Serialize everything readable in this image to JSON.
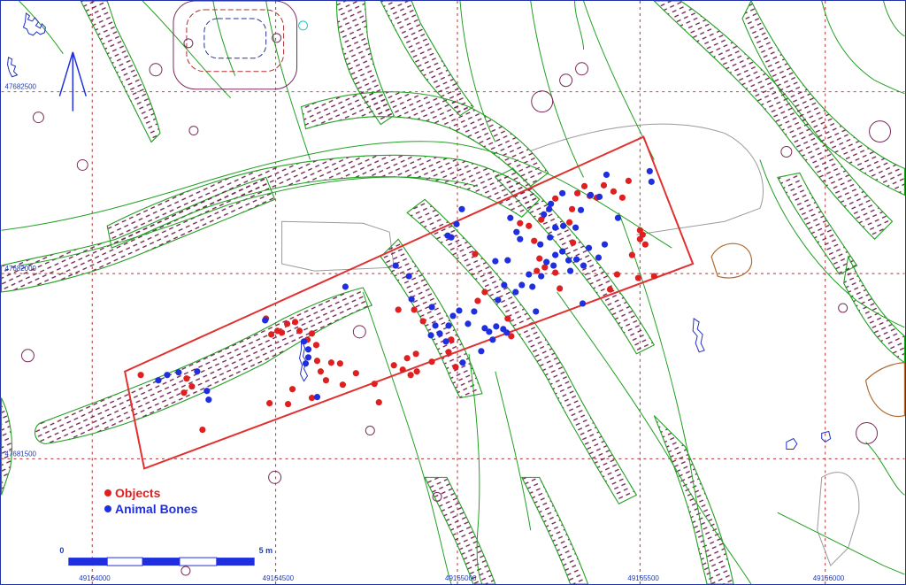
{
  "legend": {
    "objects": {
      "label": "Objects",
      "color": "#e02020"
    },
    "bones": {
      "label": "Animal Bones",
      "color": "#1f2fe0"
    }
  },
  "scale": {
    "start": "0",
    "end": "5 m"
  },
  "grid": {
    "x_labels": [
      "49164000",
      "49164500",
      "49165000",
      "49165500",
      "49166000"
    ],
    "y_labels": [
      "47682500",
      "47682000",
      "47681500"
    ]
  },
  "north_arrow": {
    "icon": "north-arrow-icon"
  },
  "colors": {
    "grid": "#b03030",
    "contours": "#22a022",
    "hatch": "#6a1a4a",
    "trench_box": "#e03030",
    "gray_outline": "#9a9a9a",
    "brown_outline": "#b06a30"
  },
  "finds": {
    "objects": [
      [
        158,
        424
      ],
      [
        210,
        428
      ],
      [
        216,
        437
      ],
      [
        207,
        444
      ],
      [
        228,
        486
      ],
      [
        300,
        360
      ],
      [
        313,
        374
      ],
      [
        306,
        378
      ],
      [
        318,
        376
      ],
      [
        324,
        366
      ],
      [
        333,
        364
      ],
      [
        338,
        374
      ],
      [
        347,
        384
      ],
      [
        352,
        377
      ],
      [
        357,
        390
      ],
      [
        358,
        408
      ],
      [
        362,
        420
      ],
      [
        368,
        430
      ],
      [
        374,
        410
      ],
      [
        384,
        411
      ],
      [
        387,
        435
      ],
      [
        330,
        440
      ],
      [
        352,
        450
      ],
      [
        325,
        457
      ],
      [
        304,
        456
      ],
      [
        402,
        422
      ],
      [
        428,
        455
      ],
      [
        423,
        434
      ],
      [
        445,
        413
      ],
      [
        455,
        418
      ],
      [
        460,
        405
      ],
      [
        470,
        400
      ],
      [
        464,
        424
      ],
      [
        471,
        420
      ],
      [
        450,
        350
      ],
      [
        468,
        350
      ],
      [
        478,
        363
      ],
      [
        510,
        384
      ],
      [
        488,
        409
      ],
      [
        507,
        398
      ],
      [
        515,
        415
      ],
      [
        540,
        340
      ],
      [
        548,
        330
      ],
      [
        574,
        360
      ],
      [
        578,
        380
      ],
      [
        537,
        287
      ],
      [
        598,
        255
      ],
      [
        604,
        272
      ],
      [
        610,
        292
      ],
      [
        607,
        306
      ],
      [
        616,
        302
      ],
      [
        628,
        308
      ],
      [
        633,
        326
      ],
      [
        653,
        218
      ],
      [
        661,
        210
      ],
      [
        667,
        221
      ],
      [
        675,
        223
      ],
      [
        683,
        209
      ],
      [
        694,
        216
      ],
      [
        704,
        223
      ],
      [
        711,
        204
      ],
      [
        644,
        251
      ],
      [
        648,
        274
      ],
      [
        628,
        224
      ],
      [
        647,
        236
      ],
      [
        588,
        252
      ],
      [
        612,
        248
      ],
      [
        724,
        260
      ],
      [
        727,
        265
      ],
      [
        724,
        270
      ],
      [
        730,
        276
      ],
      [
        690,
        327
      ],
      [
        698,
        310
      ],
      [
        715,
        288
      ],
      [
        722,
        314
      ],
      [
        740,
        312
      ]
    ],
    "bones": [
      [
        178,
        430
      ],
      [
        188,
        424
      ],
      [
        201,
        421
      ],
      [
        222,
        420
      ],
      [
        233,
        442
      ],
      [
        235,
        452
      ],
      [
        299,
        362
      ],
      [
        343,
        386
      ],
      [
        348,
        395
      ],
      [
        348,
        404
      ],
      [
        345,
        411
      ],
      [
        358,
        449
      ],
      [
        390,
        324
      ],
      [
        447,
        300
      ],
      [
        462,
        312
      ],
      [
        465,
        338
      ],
      [
        488,
        347
      ],
      [
        487,
        379
      ],
      [
        492,
        368
      ],
      [
        497,
        377
      ],
      [
        507,
        368
      ],
      [
        504,
        386
      ],
      [
        519,
        351
      ],
      [
        523,
        410
      ],
      [
        529,
        366
      ],
      [
        536,
        352
      ],
      [
        548,
        371
      ],
      [
        553,
        375
      ],
      [
        557,
        384
      ],
      [
        561,
        369
      ],
      [
        569,
        372
      ],
      [
        573,
        376
      ],
      [
        544,
        397
      ],
      [
        563,
        339
      ],
      [
        570,
        322
      ],
      [
        583,
        330
      ],
      [
        590,
        322
      ],
      [
        598,
        310
      ],
      [
        602,
        324
      ],
      [
        612,
        312
      ],
      [
        606,
        352
      ],
      [
        618,
        296
      ],
      [
        626,
        300
      ],
      [
        628,
        288
      ],
      [
        636,
        284
      ],
      [
        643,
        294
      ],
      [
        645,
        306
      ],
      [
        652,
        293
      ],
      [
        660,
        300
      ],
      [
        666,
        280
      ],
      [
        677,
        291
      ],
      [
        684,
        276
      ],
      [
        611,
        276
      ],
      [
        622,
        268
      ],
      [
        628,
        257
      ],
      [
        615,
        242
      ],
      [
        623,
        230
      ],
      [
        621,
        236
      ],
      [
        636,
        218
      ],
      [
        637,
        255
      ],
      [
        651,
        257
      ],
      [
        657,
        237
      ],
      [
        668,
        220
      ],
      [
        678,
        222
      ],
      [
        686,
        197
      ],
      [
        699,
        246
      ],
      [
        735,
        193
      ],
      [
        737,
        205
      ],
      [
        659,
        343
      ],
      [
        506,
        266
      ],
      [
        510,
        268
      ],
      [
        516,
        253
      ],
      [
        522,
        236
      ],
      [
        577,
        246
      ],
      [
        584,
        262
      ],
      [
        588,
        270
      ],
      [
        560,
        295
      ],
      [
        574,
        294
      ],
      [
        512,
        357
      ]
    ]
  }
}
